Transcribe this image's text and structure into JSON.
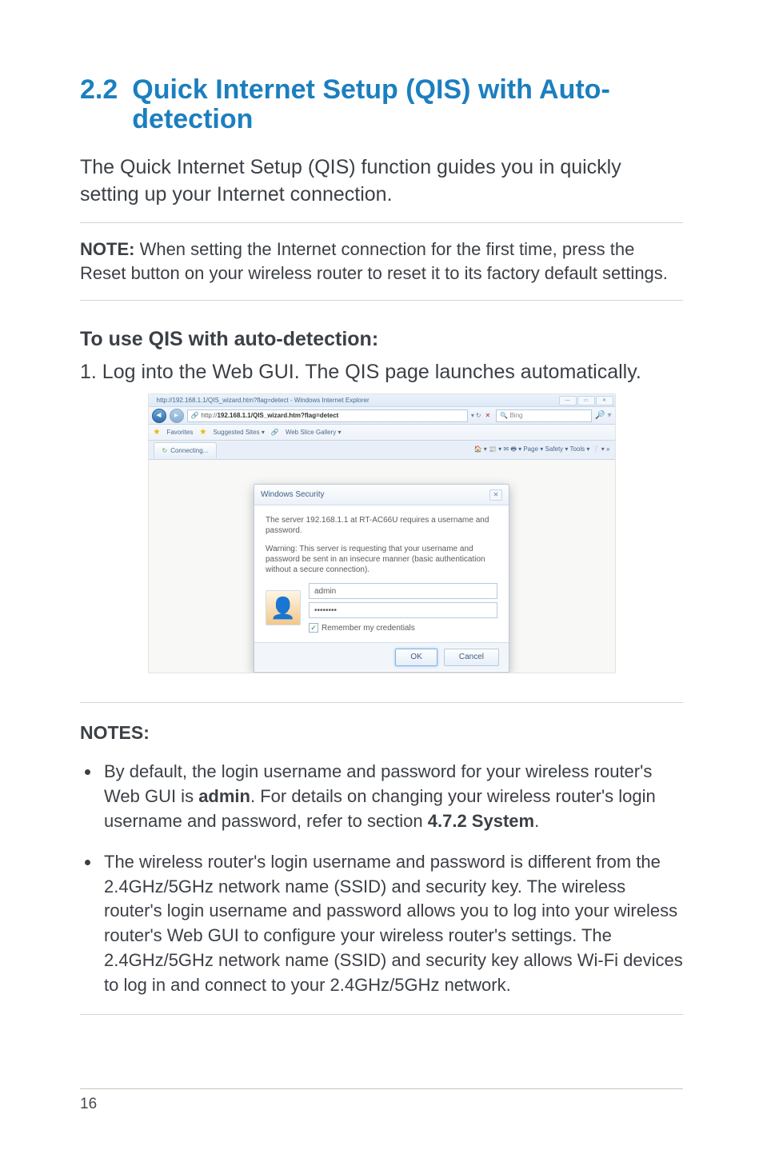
{
  "section": {
    "number": "2.2",
    "title_line1": "Quick Internet Setup (QIS) with Auto-",
    "title_line2": "detection"
  },
  "intro": "The Quick Internet Setup (QIS) function guides you in quickly setting up your Internet connection.",
  "note_label": "NOTE:",
  "note_text": "  When setting the Internet connection for the first time, press the Reset button on your wireless router to reset it to its factory default settings.",
  "sub_heading": "To use QIS with auto-detection:",
  "step_1": "1.  Log into the Web GUI. The QIS page launches automatically.",
  "screenshot": {
    "window_title": "http://192.168.1.1/QIS_wizard.htm?flag=detect - Windows Internet Explorer",
    "win": {
      "min": "—",
      "max": "▭",
      "close": "✕"
    },
    "nav": {
      "back": "◄",
      "fwd": "▸"
    },
    "address_prefix": "http://",
    "address_url": "192.168.1.1/QIS_wizard.htm?flag=detect",
    "refresh_x": "✕",
    "search_placeholder": "Bing",
    "search_engine_label": "🔍",
    "fav_label": "Favorites",
    "fav_items": [
      "Suggested Sites ▾",
      "Web Slice Gallery ▾"
    ],
    "tab_label": "Connecting...",
    "toolbar_right": "🏠 ▾  📰 ▾  ✉ 🖶 ▾  Page ▾  Safety ▾  Tools ▾  ❔ ▾  »",
    "dialog": {
      "title": "Windows Security",
      "line1": "The server 192.168.1.1 at RT-AC66U requires a username and password.",
      "line2": "Warning: This server is requesting that your username and password be sent in an insecure manner (basic authentication without a secure connection).",
      "username": "admin",
      "password": "••••••••",
      "remember": "Remember my credentials",
      "ok": "OK",
      "cancel": "Cancel"
    }
  },
  "notes_heading": "NOTES",
  "notes_colon": ":",
  "note_bullets": {
    "b1_pre": "By default, the login username and password for your wireless router's Web GUI is ",
    "b1_bold": "admin",
    "b1_mid": ". For details on changing your wireless router's login username and password, refer to section ",
    "b1_ref": "4.7.2 System",
    "b1_end": ".",
    "b2": "The wireless router's login username and password is different from the 2.4GHz/5GHz network name (SSID) and security key. The wireless router's login username and password allows you to log into your wireless router's Web GUI to configure your wireless router's settings. The 2.4GHz/5GHz network name (SSID) and security key allows Wi-Fi devices to log in and connect to your 2.4GHz/5GHz network."
  },
  "page_number": "16"
}
